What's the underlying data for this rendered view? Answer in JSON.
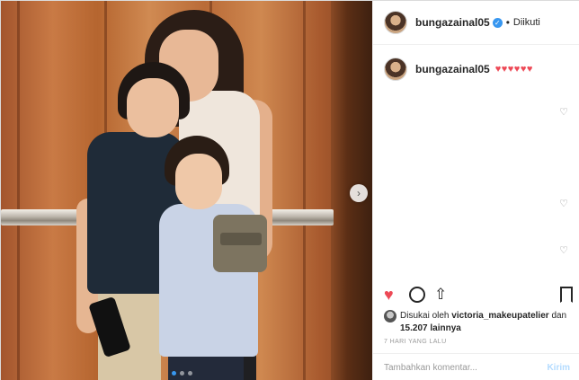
{
  "header": {
    "username": "bungazainal05",
    "separator": "•",
    "follow_status": "Diikuti"
  },
  "caption": {
    "username": "bungazainal05",
    "hearts": "♥♥♥♥♥♥"
  },
  "icons": {
    "verified": "verified-badge-icon",
    "like": "heart-filled-icon",
    "comment": "comment-bubble-icon",
    "share": "share-upload-icon",
    "save": "bookmark-icon",
    "next": "chevron-right-icon"
  },
  "glyphs": {
    "verified": "✓",
    "like": "♥",
    "share": "⇧",
    "next": "›",
    "small_heart": "♡"
  },
  "likes": {
    "prefix": "Disukai oleh",
    "user": "victoria_makeupatelier",
    "conjunction": "dan",
    "count": "15.207",
    "suffix": "lainnya"
  },
  "time_ago": "7 HARI YANG LALU",
  "comment_box": {
    "placeholder": "Tambahkan komentar...",
    "post_label": "Kirim"
  },
  "carousel": {
    "total": 3,
    "active_index": 0
  },
  "colors": {
    "like": "#ed4956",
    "verified": "#3897f0",
    "post_disabled": "#b3dbff"
  }
}
